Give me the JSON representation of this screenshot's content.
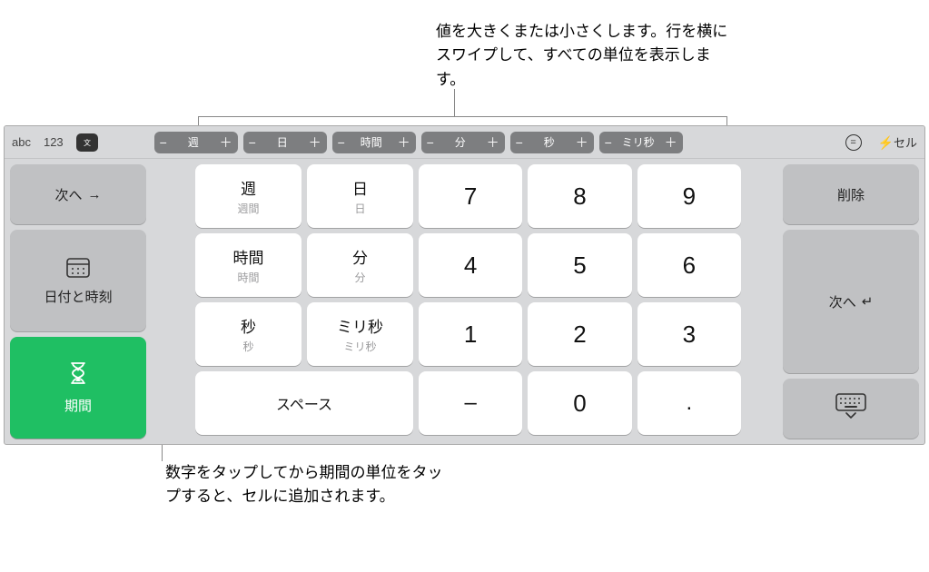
{
  "callouts": {
    "top": "値を大きくまたは小さくします。行を横にスワイプして、すべての単位を表示します。",
    "bottom": "数字をタップしてから期間の単位をタップすると、セルに追加されます。"
  },
  "topbar": {
    "abc": "abc",
    "num": "123",
    "lang_icon_label": "言語",
    "steppers": [
      {
        "label": "週"
      },
      {
        "label": "日"
      },
      {
        "label": "時間"
      },
      {
        "label": "分"
      },
      {
        "label": "秒"
      },
      {
        "label": "ミリ秒"
      }
    ],
    "equals_label": "=",
    "cell_label": "セル",
    "bolt": "⚡"
  },
  "left": {
    "next": "次へ",
    "next_arrow": "→",
    "datetime": "日付と時刻",
    "duration": "期間"
  },
  "right": {
    "delete": "削除",
    "next": "次へ",
    "return_arrow": "↵"
  },
  "units": [
    [
      {
        "big": "週",
        "small": "週間"
      },
      {
        "big": "日",
        "small": "日"
      }
    ],
    [
      {
        "big": "時間",
        "small": "時間"
      },
      {
        "big": "分",
        "small": "分"
      }
    ],
    [
      {
        "big": "秒",
        "small": "秒"
      },
      {
        "big": "ミリ秒",
        "small": "ミリ秒"
      }
    ]
  ],
  "numbers": [
    [
      "7",
      "8",
      "9"
    ],
    [
      "4",
      "5",
      "6"
    ],
    [
      "1",
      "2",
      "3"
    ]
  ],
  "bottom_row": {
    "space": "スペース",
    "minus": "–",
    "zero": "0",
    "dot": "."
  }
}
